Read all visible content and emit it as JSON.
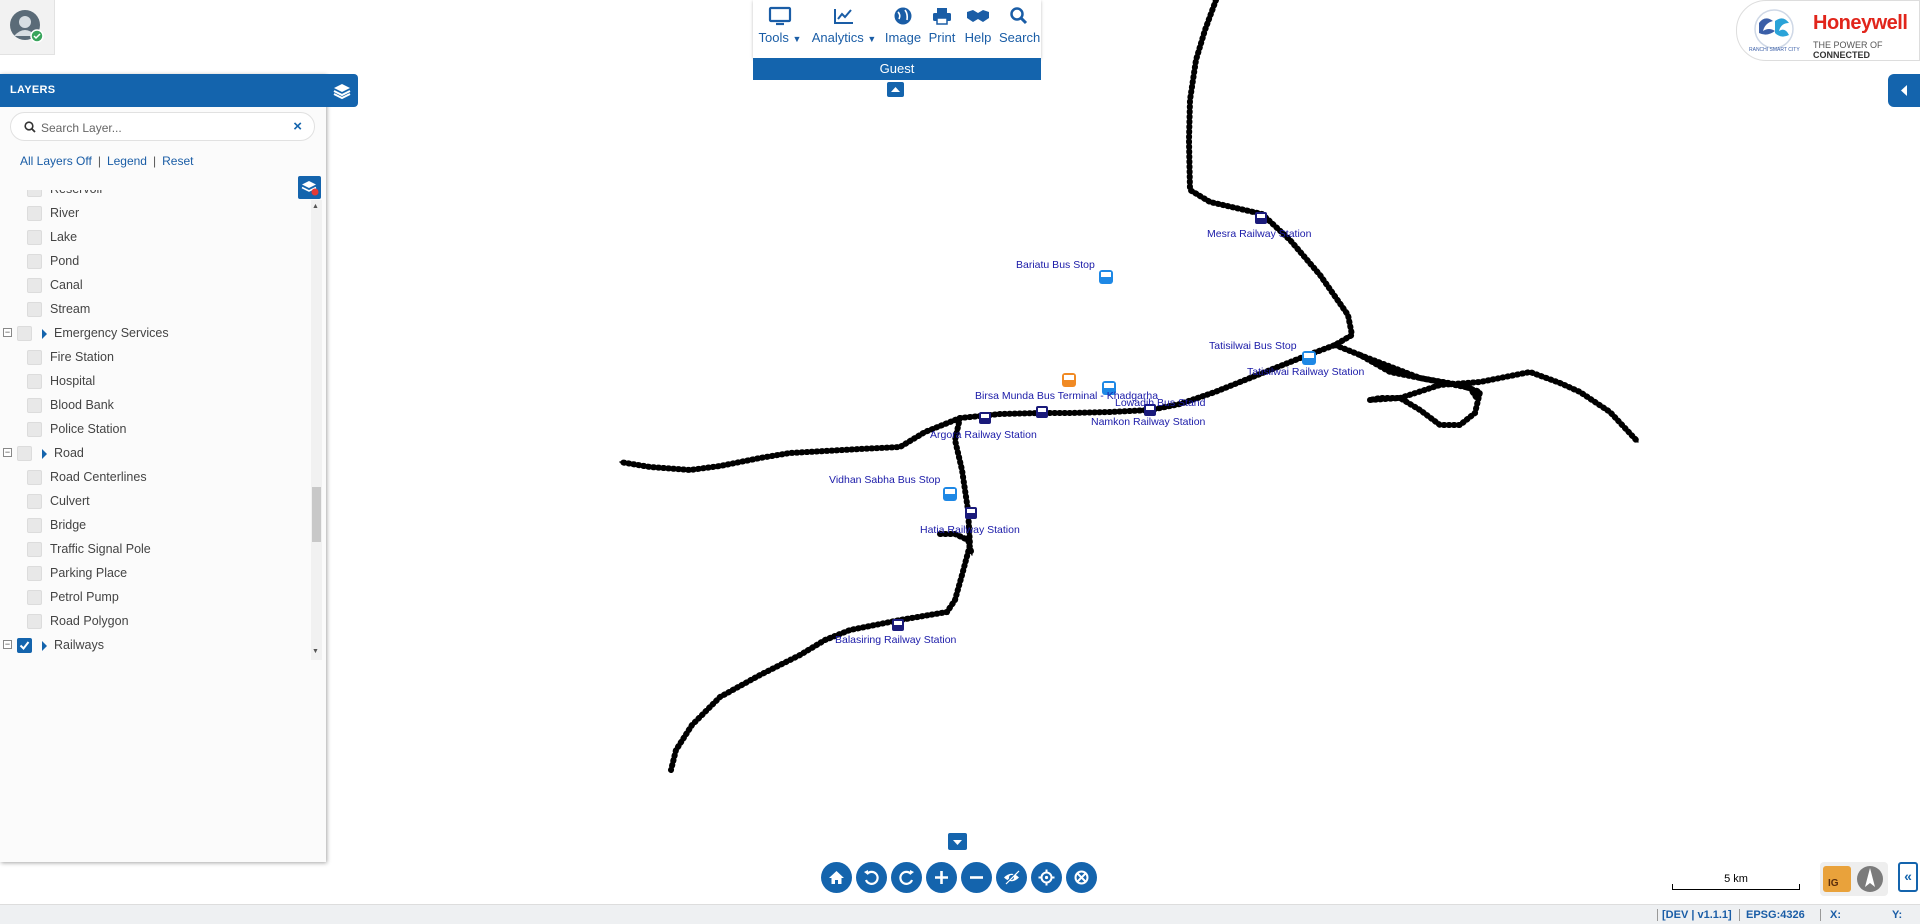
{
  "layers_panel": {
    "title": "LAYERS",
    "search_placeholder": "Search Layer...",
    "clear_label": "×",
    "links": {
      "all_off": "All Layers Off",
      "legend": "Legend",
      "reset": "Reset"
    },
    "items": [
      {
        "label": "Reservoir",
        "level": 1,
        "checked": false
      },
      {
        "label": "River",
        "level": 1,
        "checked": false
      },
      {
        "label": "Lake",
        "level": 1,
        "checked": false
      },
      {
        "label": "Pond",
        "level": 1,
        "checked": false
      },
      {
        "label": "Canal",
        "level": 1,
        "checked": false
      },
      {
        "label": "Stream",
        "level": 1,
        "checked": false
      },
      {
        "label": "Emergency Services",
        "level": 0,
        "checked": false
      },
      {
        "label": "Fire Station",
        "level": 1,
        "checked": false
      },
      {
        "label": "Hospital",
        "level": 1,
        "checked": false
      },
      {
        "label": "Blood Bank",
        "level": 1,
        "checked": false
      },
      {
        "label": "Police Station",
        "level": 1,
        "checked": false
      },
      {
        "label": "Road",
        "level": 0,
        "checked": false
      },
      {
        "label": "Road Centerlines",
        "level": 1,
        "checked": false
      },
      {
        "label": "Culvert",
        "level": 1,
        "checked": false
      },
      {
        "label": "Bridge",
        "level": 1,
        "checked": false
      },
      {
        "label": "Traffic Signal Pole",
        "level": 1,
        "checked": false
      },
      {
        "label": "Parking Place",
        "level": 1,
        "checked": false
      },
      {
        "label": "Petrol Pump",
        "level": 1,
        "checked": false
      },
      {
        "label": "Road Polygon",
        "level": 1,
        "checked": false
      },
      {
        "label": "Railways",
        "level": 0,
        "checked": true
      }
    ]
  },
  "toolbar": {
    "tools": "Tools",
    "analytics": "Analytics",
    "image": "Image",
    "print": "Print",
    "help": "Help",
    "search": "Search",
    "user": "Guest"
  },
  "logo": {
    "brand": "Honeywell",
    "tagline_a": "THE POWER OF ",
    "tagline_b": "CONNECTED",
    "city": "RANCHI SMART CITY"
  },
  "map": {
    "labels": {
      "mesra": "Mesra Railway Station",
      "bariatu": "Bariatu Bus Stop",
      "tatisilwai_bus": "Tatisilwai Bus Stop",
      "tatisilwai_rail": "Tatisilwai Railway Station",
      "birsa": "Birsa Munda Bus Terminal - Khadgarha",
      "lowadih": "Lowadih Bus Stand",
      "namkon": "Namkon Railway Station",
      "argora": "Argora Railway Station",
      "vidhan": "Vidhan Sabha Bus Stop",
      "hatia": "Hatia Railway Station",
      "balasiring": "Balasiring Railway Station"
    },
    "scale": "5 km"
  },
  "statusbar": {
    "env": "[DEV | v1.1.1]",
    "epsg": "EPSG:4326",
    "x": "X:",
    "y": "Y:"
  },
  "colors": {
    "primary": "#1464ad",
    "map_label": "#1a1aa8",
    "bus_blue": "#1e88e5",
    "bus_orange": "#f08a24",
    "honeywell": "#e1251b"
  }
}
